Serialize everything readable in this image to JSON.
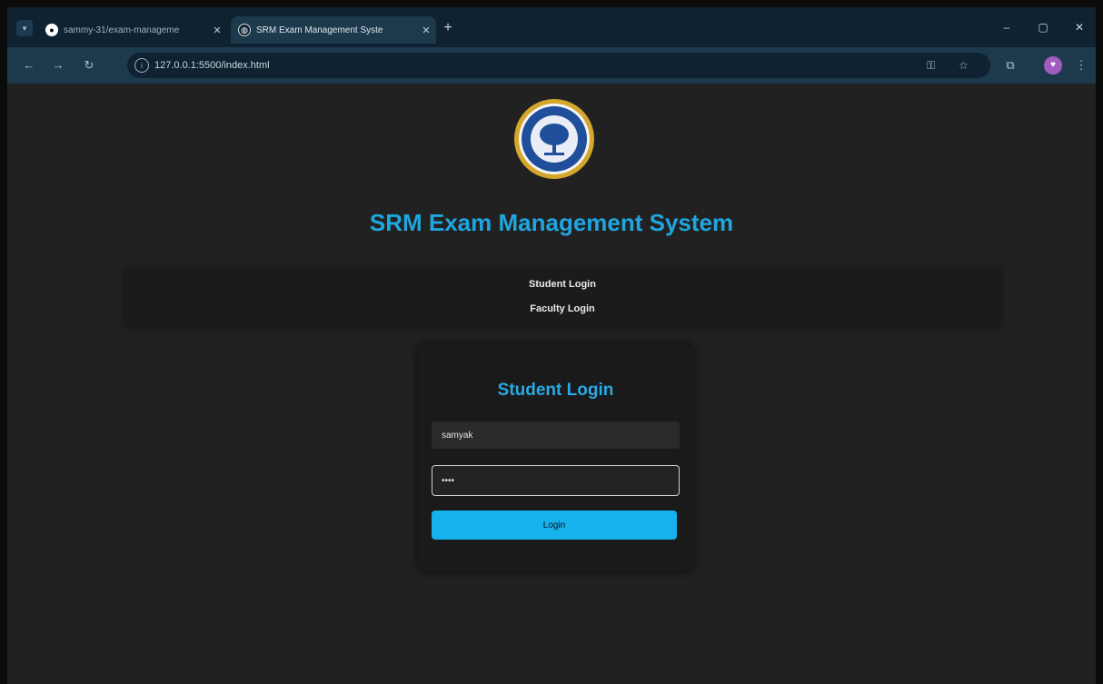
{
  "browser": {
    "tabs": [
      {
        "title": "sammy-31/exam-manageme",
        "active": false,
        "favicon": "github-icon"
      },
      {
        "title": "SRM Exam Management Syste",
        "active": true,
        "favicon": "globe-icon"
      }
    ],
    "close_glyph": "✕",
    "new_tab_glyph": "+",
    "url": "127.0.0.1:5500/index.html",
    "window_controls": {
      "minimize": "–",
      "maximize": "▢",
      "close": "✕"
    },
    "nav_glyphs": {
      "back": "←",
      "forward": "→",
      "reload": "↻"
    },
    "profile_initial": "♥"
  },
  "page": {
    "title": "SRM Exam Management System",
    "nav": [
      "Student Login",
      "Faculty Login"
    ],
    "login_card": {
      "title": "Student Login",
      "username_value": "samyak",
      "password_value": "••••",
      "button_label": "Login"
    }
  },
  "colors": {
    "accent": "#1fa6e0",
    "button": "#16b2ee",
    "background": "#212121",
    "seal_gold": "#d4a72c",
    "seal_blue": "#1f4f9a"
  }
}
